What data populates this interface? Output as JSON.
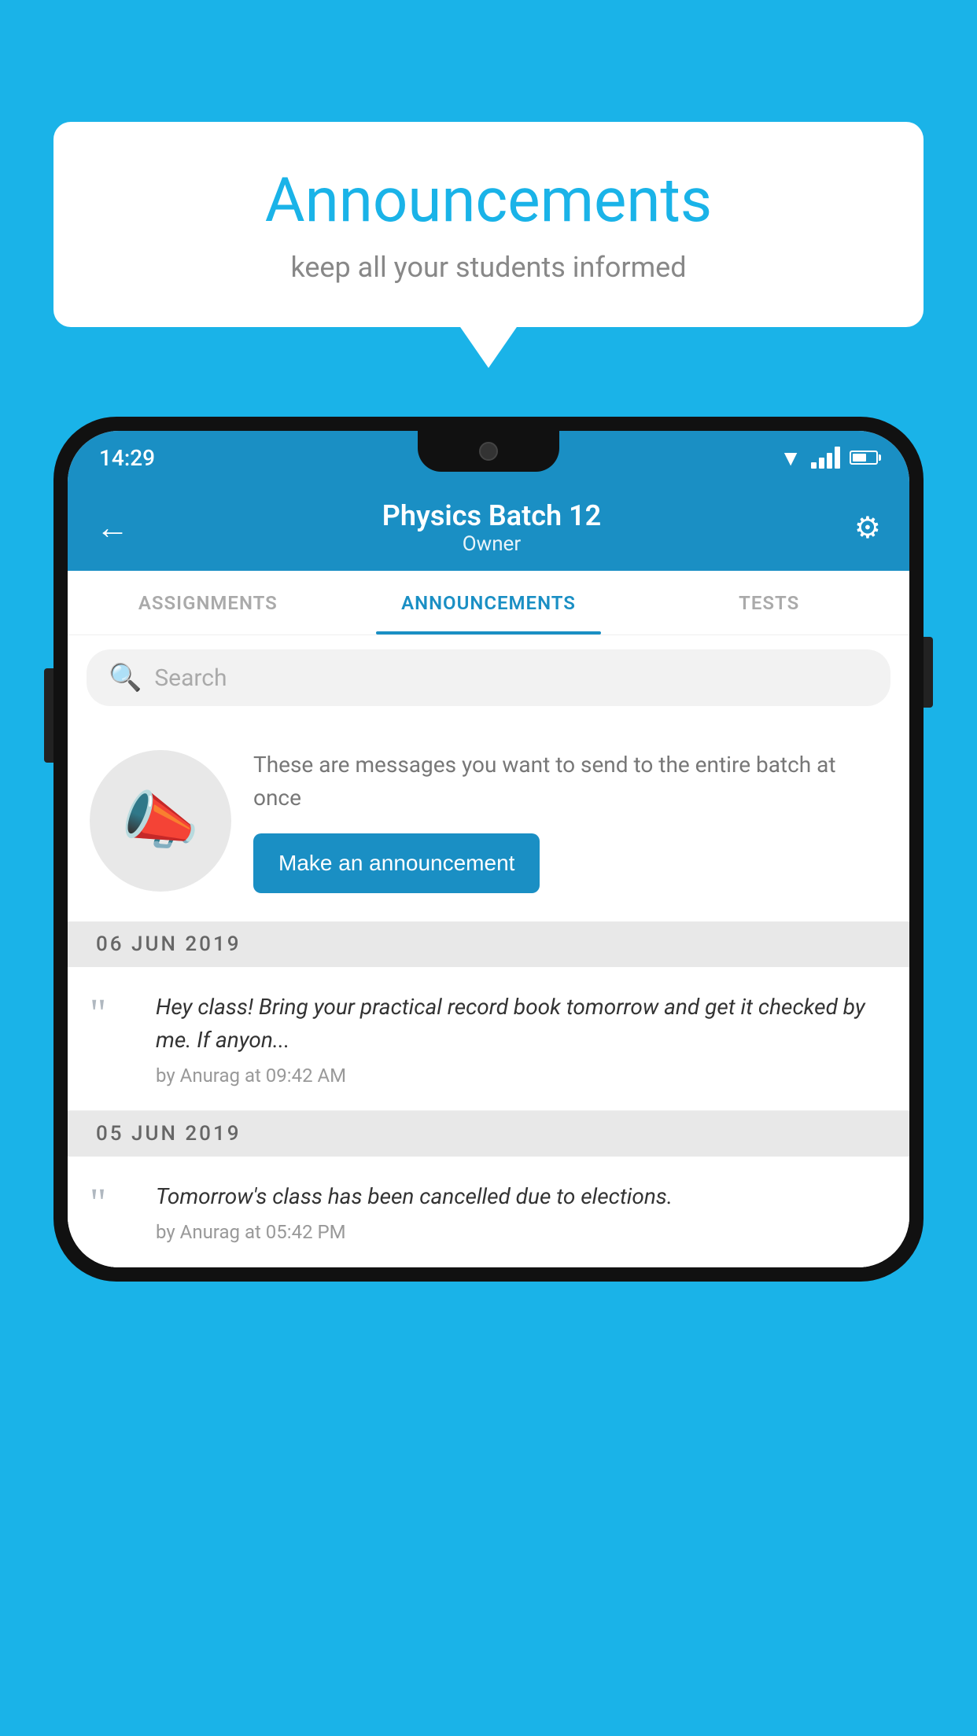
{
  "background_color": "#1ab3e8",
  "speech_bubble": {
    "title": "Announcements",
    "subtitle": "keep all your students informed"
  },
  "phone": {
    "status_bar": {
      "time": "14:29"
    },
    "header": {
      "title": "Physics Batch 12",
      "subtitle": "Owner",
      "back_label": "←",
      "gear_label": "⚙"
    },
    "tabs": [
      {
        "label": "ASSIGNMENTS",
        "active": false
      },
      {
        "label": "ANNOUNCEMENTS",
        "active": true
      },
      {
        "label": "TESTS",
        "active": false
      }
    ],
    "search": {
      "placeholder": "Search"
    },
    "announcement_intro": {
      "description_text": "These are messages you want to send to the entire batch at once",
      "button_label": "Make an announcement"
    },
    "announcement_groups": [
      {
        "date": "06  JUN  2019",
        "items": [
          {
            "message": "Hey class! Bring your practical record book tomorrow and get it checked by me. If anyon...",
            "meta": "by Anurag at 09:42 AM"
          }
        ]
      },
      {
        "date": "05  JUN  2019",
        "items": [
          {
            "message": "Tomorrow's class has been cancelled due to elections.",
            "meta": "by Anurag at 05:42 PM"
          }
        ]
      }
    ]
  }
}
